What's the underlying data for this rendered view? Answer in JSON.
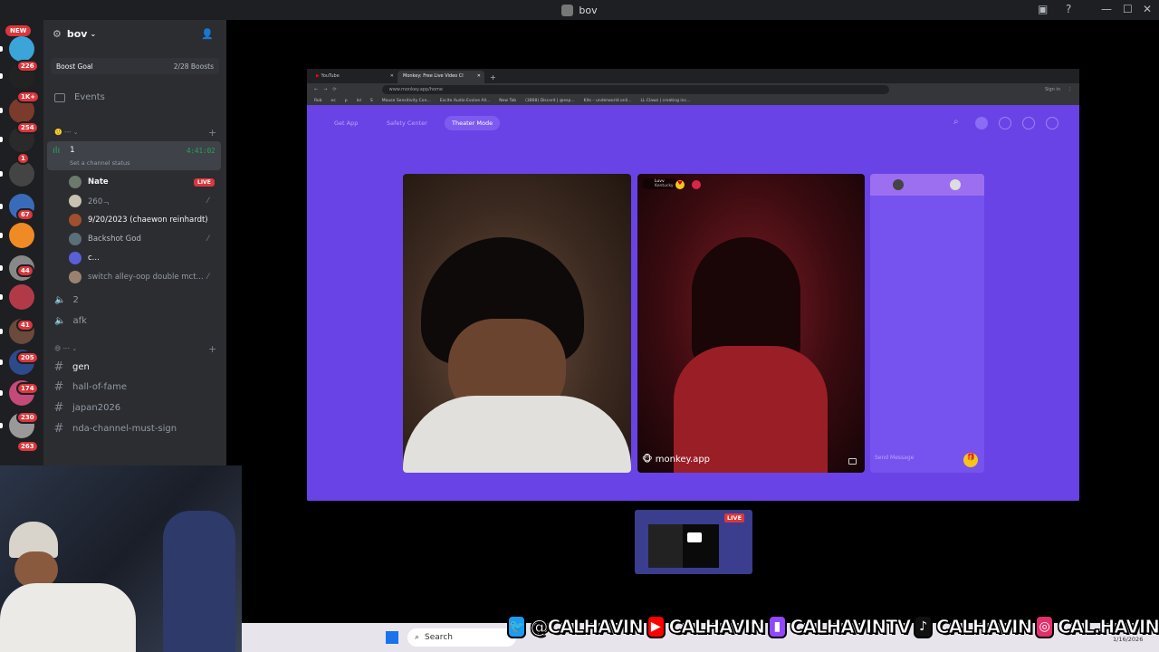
{
  "titlebar": {
    "title": "bov"
  },
  "rail": {
    "new_label": "NEW",
    "badges": [
      "226",
      "1K+",
      "254",
      "1",
      "67",
      "44",
      "41",
      "205",
      "174",
      "230",
      "263"
    ]
  },
  "sidebar": {
    "server_name": "bov",
    "boost_goal": {
      "label": "Boost Goal",
      "progress": "2/28 Boosts"
    },
    "events": "Events",
    "voice_channel": {
      "name": "1",
      "timer": "4:41:02",
      "status": "Set a channel status"
    },
    "voice_users": [
      {
        "name": "Nate",
        "live": "LIVE"
      },
      {
        "name": "260ᆨ"
      },
      {
        "name": "9/20/2023 (chaewon reinhardt)"
      },
      {
        "name": "Backshot God"
      },
      {
        "name": "c..."
      },
      {
        "name": "switch alley-oop double mct..."
      }
    ],
    "voice_channels": [
      "2",
      "afk"
    ],
    "text_channels": [
      "gen",
      "hall-of-fame",
      "japan2026",
      "nda-channel-must-sign"
    ]
  },
  "browser": {
    "tabs": [
      "YouTube",
      "Monkey: Free Live Video Cl"
    ],
    "url": "www.monkey.app/home",
    "bookmarks": [
      "Rob",
      "ec",
      "p",
      "lol",
      "S",
      "Mouse Sensitivity Con...",
      "Excite Audio Evolve All...",
      "New Tab",
      "(3868) Discord | @esp...",
      "Kits – underworld onli...",
      "LL Clawz | creating inc..."
    ],
    "signin": "Sign in",
    "nav": {
      "get_app": "Get App",
      "safety": "Safety Center",
      "theater": "Theater Mode"
    },
    "remote_user": {
      "name": "Luvv",
      "sub": "Kentucky"
    },
    "watermark": "monkey.app",
    "chat_placeholder": "Send Message"
  },
  "mini": {
    "live": "LIVE"
  },
  "taskbar": {
    "search": "Search",
    "date": "1/16/2026"
  },
  "socials": [
    "@CALHAVIN",
    "CALHAVIN",
    "CALHAVINTV",
    "CALHAVIN",
    "CAL.HAVIN"
  ],
  "colors": {
    "accent": "#6a43e6",
    "discord_bg": "#2b2d31",
    "live_red": "#da373c"
  }
}
